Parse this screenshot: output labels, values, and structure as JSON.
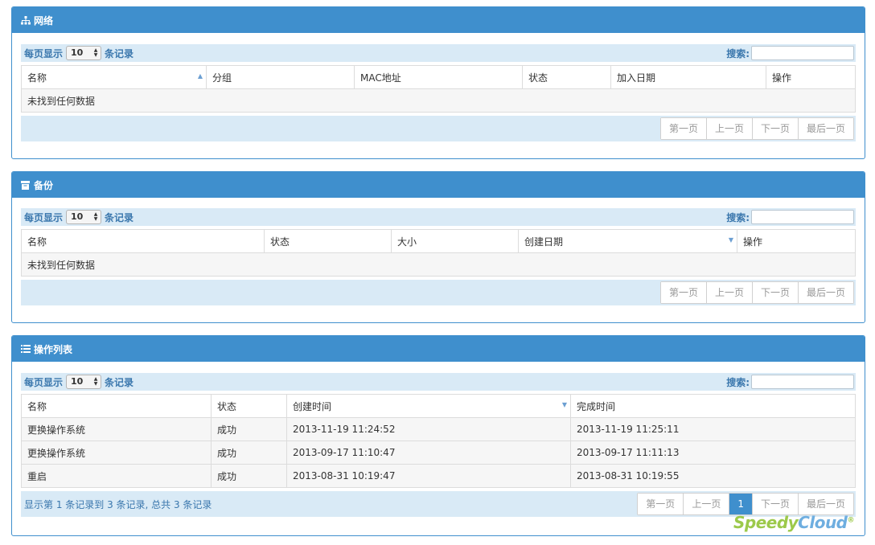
{
  "common": {
    "per_page_prefix": "每页显示",
    "per_page_value": "10",
    "per_page_suffix": "条记录",
    "search_label": "搜索:",
    "empty_text": "未找到任何数据",
    "pager": [
      "第一页",
      "上一页",
      "下一页",
      "最后一页"
    ]
  },
  "network": {
    "title": "网络",
    "headers": [
      "名称",
      "分组",
      "MAC地址",
      "状态",
      "加入日期",
      "操作"
    ]
  },
  "backup": {
    "title": "备份",
    "headers": [
      "名称",
      "状态",
      "大小",
      "创建日期",
      "操作"
    ]
  },
  "operations": {
    "title": "操作列表",
    "headers": [
      "名称",
      "状态",
      "创建时间",
      "完成时间"
    ],
    "rows": [
      [
        "更换操作系统",
        "成功",
        "2013-11-19 11:24:52",
        "2013-11-19 11:25:11"
      ],
      [
        "更换操作系统",
        "成功",
        "2013-09-17 11:10:47",
        "2013-09-17 11:11:13"
      ],
      [
        "重启",
        "成功",
        "2013-08-31 10:19:47",
        "2013-08-31 10:19:55"
      ]
    ],
    "summary": "显示第 1 条记录到 3 条记录, 总共 3 条记录",
    "pager": [
      "第一页",
      "上一页",
      "1",
      "下一页",
      "最后一页"
    ]
  },
  "logo": {
    "text_a": "Speedy",
    "text_b": "Cloud",
    "mark": "®"
  },
  "colors": {
    "header": "#3f8fcd",
    "toolbar": "#d9eaf6",
    "link": "#3a77ad"
  }
}
